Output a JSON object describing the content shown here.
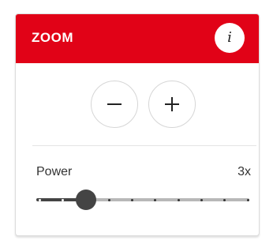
{
  "panel": {
    "title": "ZOOM",
    "info_icon": "info-icon",
    "info_glyph": "i",
    "accent_color": "#e10217"
  },
  "zoom_controls": {
    "zoom_out_icon": "minus-icon",
    "zoom_in_icon": "plus-icon"
  },
  "power": {
    "label": "Power",
    "value_text": "3x",
    "slider": {
      "stops": 10,
      "selected_index": 2,
      "fill_color": "#444444",
      "track_color": "#b8b8b8"
    }
  }
}
